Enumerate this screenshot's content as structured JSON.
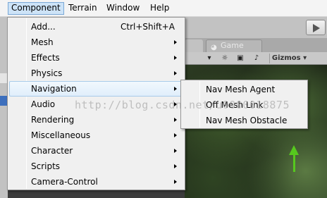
{
  "menubar": {
    "items": [
      {
        "label": "Component",
        "active": true
      },
      {
        "label": "Terrain"
      },
      {
        "label": "Window"
      },
      {
        "label": "Help"
      }
    ]
  },
  "unity": {
    "game_tab_label": "Game",
    "gizmos_label": "Gizmos"
  },
  "component_menu": {
    "items": [
      {
        "label": "Add...",
        "shortcut": "Ctrl+Shift+A",
        "submenu": false
      },
      {
        "label": "Mesh",
        "submenu": true
      },
      {
        "label": "Effects",
        "submenu": true
      },
      {
        "label": "Physics",
        "submenu": true
      },
      {
        "label": "Navigation",
        "submenu": true,
        "highlighted": true
      },
      {
        "label": "Audio",
        "submenu": true
      },
      {
        "label": "Rendering",
        "submenu": true
      },
      {
        "label": "Miscellaneous",
        "submenu": true
      },
      {
        "label": "Character",
        "submenu": true
      },
      {
        "label": "Scripts",
        "submenu": true
      },
      {
        "label": "Camera-Control",
        "submenu": true
      }
    ]
  },
  "navigation_submenu": {
    "items": [
      {
        "label": "Nav Mesh Agent"
      },
      {
        "label": "Off Mesh Link"
      },
      {
        "label": "Nav Mesh Obstacle"
      }
    ]
  },
  "watermark": "http://blog.csdn.net/u0000018875",
  "colors": {
    "menu_bg": "#f0f0f0",
    "highlight_bg": "#e0eefb",
    "highlight_border": "#a8cbe9",
    "menubar_active_bg": "#cde3f7",
    "gizmo_green": "#56c81e"
  }
}
